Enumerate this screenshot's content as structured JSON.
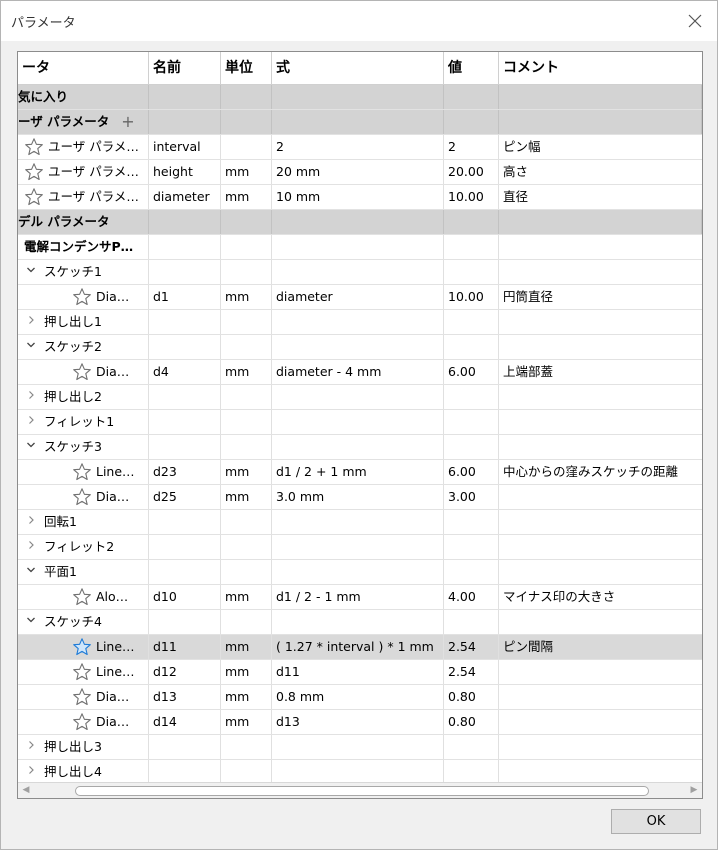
{
  "window": {
    "title": "パラメータ"
  },
  "columns": [
    "ータ",
    "名前",
    "単位",
    "式",
    "値",
    "コメント"
  ],
  "rows": [
    {
      "type": "group",
      "indent": 0,
      "label": "気に入り",
      "name": "",
      "unit": "",
      "expr": "",
      "value": "",
      "comment": ""
    },
    {
      "type": "group",
      "indent": 0,
      "label": "ーザ パラメータ",
      "plus": "+",
      "name": "",
      "unit": "",
      "expr": "",
      "value": "",
      "comment": ""
    },
    {
      "type": "param",
      "indent": 1,
      "star": true,
      "label": "ユーザ パラメ…",
      "name": "interval",
      "unit": "",
      "expr": "2",
      "value": "2",
      "comment": "ピン幅"
    },
    {
      "type": "param",
      "indent": 1,
      "star": true,
      "label": "ユーザ パラメ…",
      "name": "height",
      "unit": "mm",
      "expr": "20 mm",
      "value": "20.00",
      "comment": "高さ"
    },
    {
      "type": "param",
      "indent": 1,
      "star": true,
      "label": "ユーザ パラメ…",
      "name": "diameter",
      "unit": "mm",
      "expr": "10 mm",
      "value": "10.00",
      "comment": "直径"
    },
    {
      "type": "group",
      "indent": 0,
      "label": "デル パラメータ",
      "name": "",
      "unit": "",
      "expr": "",
      "value": "",
      "comment": ""
    },
    {
      "type": "node",
      "indent": 1,
      "bold": true,
      "label": "電解コンデンサP…",
      "name": "",
      "unit": "",
      "expr": "",
      "value": "",
      "comment": ""
    },
    {
      "type": "node",
      "indent": 1,
      "chev": "down",
      "label": "スケッチ1",
      "name": "",
      "unit": "",
      "expr": "",
      "value": "",
      "comment": ""
    },
    {
      "type": "param",
      "indent": 3,
      "star": true,
      "label": "Dia…",
      "name": "d1",
      "unit": "mm",
      "expr": "diameter",
      "value": "10.00",
      "comment": "円筒直径"
    },
    {
      "type": "node",
      "indent": 1,
      "chev": "right",
      "label": "押し出し1",
      "name": "",
      "unit": "",
      "expr": "",
      "value": "",
      "comment": ""
    },
    {
      "type": "node",
      "indent": 1,
      "chev": "down",
      "label": "スケッチ2",
      "name": "",
      "unit": "",
      "expr": "",
      "value": "",
      "comment": ""
    },
    {
      "type": "param",
      "indent": 3,
      "star": true,
      "label": "Dia…",
      "name": "d4",
      "unit": "mm",
      "expr": "diameter - 4 mm",
      "value": "6.00",
      "comment": "上端部蓋"
    },
    {
      "type": "node",
      "indent": 1,
      "chev": "right",
      "label": "押し出し2",
      "name": "",
      "unit": "",
      "expr": "",
      "value": "",
      "comment": ""
    },
    {
      "type": "node",
      "indent": 1,
      "chev": "right",
      "label": "フィレット1",
      "name": "",
      "unit": "",
      "expr": "",
      "value": "",
      "comment": ""
    },
    {
      "type": "node",
      "indent": 1,
      "chev": "down",
      "label": "スケッチ3",
      "name": "",
      "unit": "",
      "expr": "",
      "value": "",
      "comment": ""
    },
    {
      "type": "param",
      "indent": 3,
      "star": true,
      "label": "Line…",
      "name": "d23",
      "unit": "mm",
      "expr": "d1 / 2 + 1 mm",
      "value": "6.00",
      "comment": "中心からの窪みスケッチの距離"
    },
    {
      "type": "param",
      "indent": 3,
      "star": true,
      "label": "Dia…",
      "name": "d25",
      "unit": "mm",
      "expr": "3.0 mm",
      "value": "3.00",
      "comment": ""
    },
    {
      "type": "node",
      "indent": 1,
      "chev": "right",
      "label": "回転1",
      "name": "",
      "unit": "",
      "expr": "",
      "value": "",
      "comment": ""
    },
    {
      "type": "node",
      "indent": 1,
      "chev": "right",
      "label": "フィレット2",
      "name": "",
      "unit": "",
      "expr": "",
      "value": "",
      "comment": ""
    },
    {
      "type": "node",
      "indent": 1,
      "chev": "down",
      "label": "平面1",
      "name": "",
      "unit": "",
      "expr": "",
      "value": "",
      "comment": ""
    },
    {
      "type": "param",
      "indent": 3,
      "star": true,
      "label": "Alo…",
      "name": "d10",
      "unit": "mm",
      "expr": "d1 / 2 - 1 mm",
      "value": "4.00",
      "comment": "マイナス印の大きさ"
    },
    {
      "type": "node",
      "indent": 1,
      "chev": "down",
      "label": "スケッチ4",
      "name": "",
      "unit": "",
      "expr": "",
      "value": "",
      "comment": ""
    },
    {
      "type": "param",
      "indent": 3,
      "star": true,
      "starBlue": true,
      "selected": true,
      "label": "Line…",
      "name": "d11",
      "unit": "mm",
      "expr": "( 1.27 * interval ) * 1 mm",
      "value": "2.54",
      "comment": "ピン間隔"
    },
    {
      "type": "param",
      "indent": 3,
      "star": true,
      "label": "Line…",
      "name": "d12",
      "unit": "mm",
      "expr": "d11",
      "value": "2.54",
      "comment": ""
    },
    {
      "type": "param",
      "indent": 3,
      "star": true,
      "label": "Dia…",
      "name": "d13",
      "unit": "mm",
      "expr": "0.8 mm",
      "value": "0.80",
      "comment": ""
    },
    {
      "type": "param",
      "indent": 3,
      "star": true,
      "label": "Dia…",
      "name": "d14",
      "unit": "mm",
      "expr": "d13",
      "value": "0.80",
      "comment": ""
    },
    {
      "type": "node",
      "indent": 1,
      "chev": "right",
      "label": "押し出し3",
      "name": "",
      "unit": "",
      "expr": "",
      "value": "",
      "comment": ""
    },
    {
      "type": "node",
      "indent": 1,
      "chev": "right",
      "label": "押し出し4",
      "name": "",
      "unit": "",
      "expr": "",
      "value": "",
      "comment": ""
    }
  ],
  "buttons": {
    "ok": "OK"
  },
  "icons": {
    "close": "close-icon",
    "star": "star-icon",
    "expanded": "chevron-down-icon",
    "collapsed": "chevron-right-icon"
  },
  "colors": {
    "group_bg": "#d3d3d3",
    "selected_bg": "#d9d9d9",
    "star_blue": "#1e7bd7",
    "star_gray": "#707070"
  }
}
